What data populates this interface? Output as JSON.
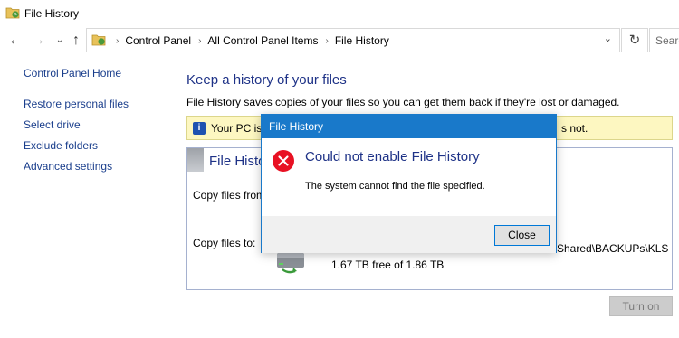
{
  "window": {
    "title": "File History"
  },
  "address_bar": {
    "breadcrumbs": [
      "Control Panel",
      "All Control Panel Items",
      "File History"
    ],
    "search_placeholder": "Search"
  },
  "nav": {
    "back_glyph": "←",
    "forward_glyph": "→",
    "up_glyph": "↑",
    "recent_glyph": "⌄",
    "dropdown_glyph": "⌄",
    "refresh_glyph": "↻",
    "sep_glyph": "›"
  },
  "sidebar": {
    "home": "Control Panel Home",
    "links": [
      "Restore personal files",
      "Select drive",
      "Exclude folders",
      "Advanced settings"
    ]
  },
  "main": {
    "title": "Keep a history of your files",
    "description": "File History saves copies of your files so you can get them back if they're lost or damaged.",
    "info_bar": {
      "text_start": "Your PC is p",
      "text_end": "s not.",
      "icon_glyph": "i"
    },
    "panel": {
      "title": "File Histo",
      "copy_from_label": "Copy files from:",
      "copy_to_label": "Copy files to:",
      "drive_path": "Shared\\BACKUPs\\KLS",
      "drive_free": "1.67 TB free of 1.86 TB"
    },
    "turn_on_label": "Turn on"
  },
  "dialog": {
    "title": "File History",
    "heading": "Could not enable File History",
    "message": "The system cannot find the file specified.",
    "close_label": "Close"
  },
  "colors": {
    "accent": "#1979ca",
    "link": "#1a3e8c",
    "heading": "#1e3287",
    "info_bg": "#fdf7c1",
    "error_red": "#e81123"
  }
}
